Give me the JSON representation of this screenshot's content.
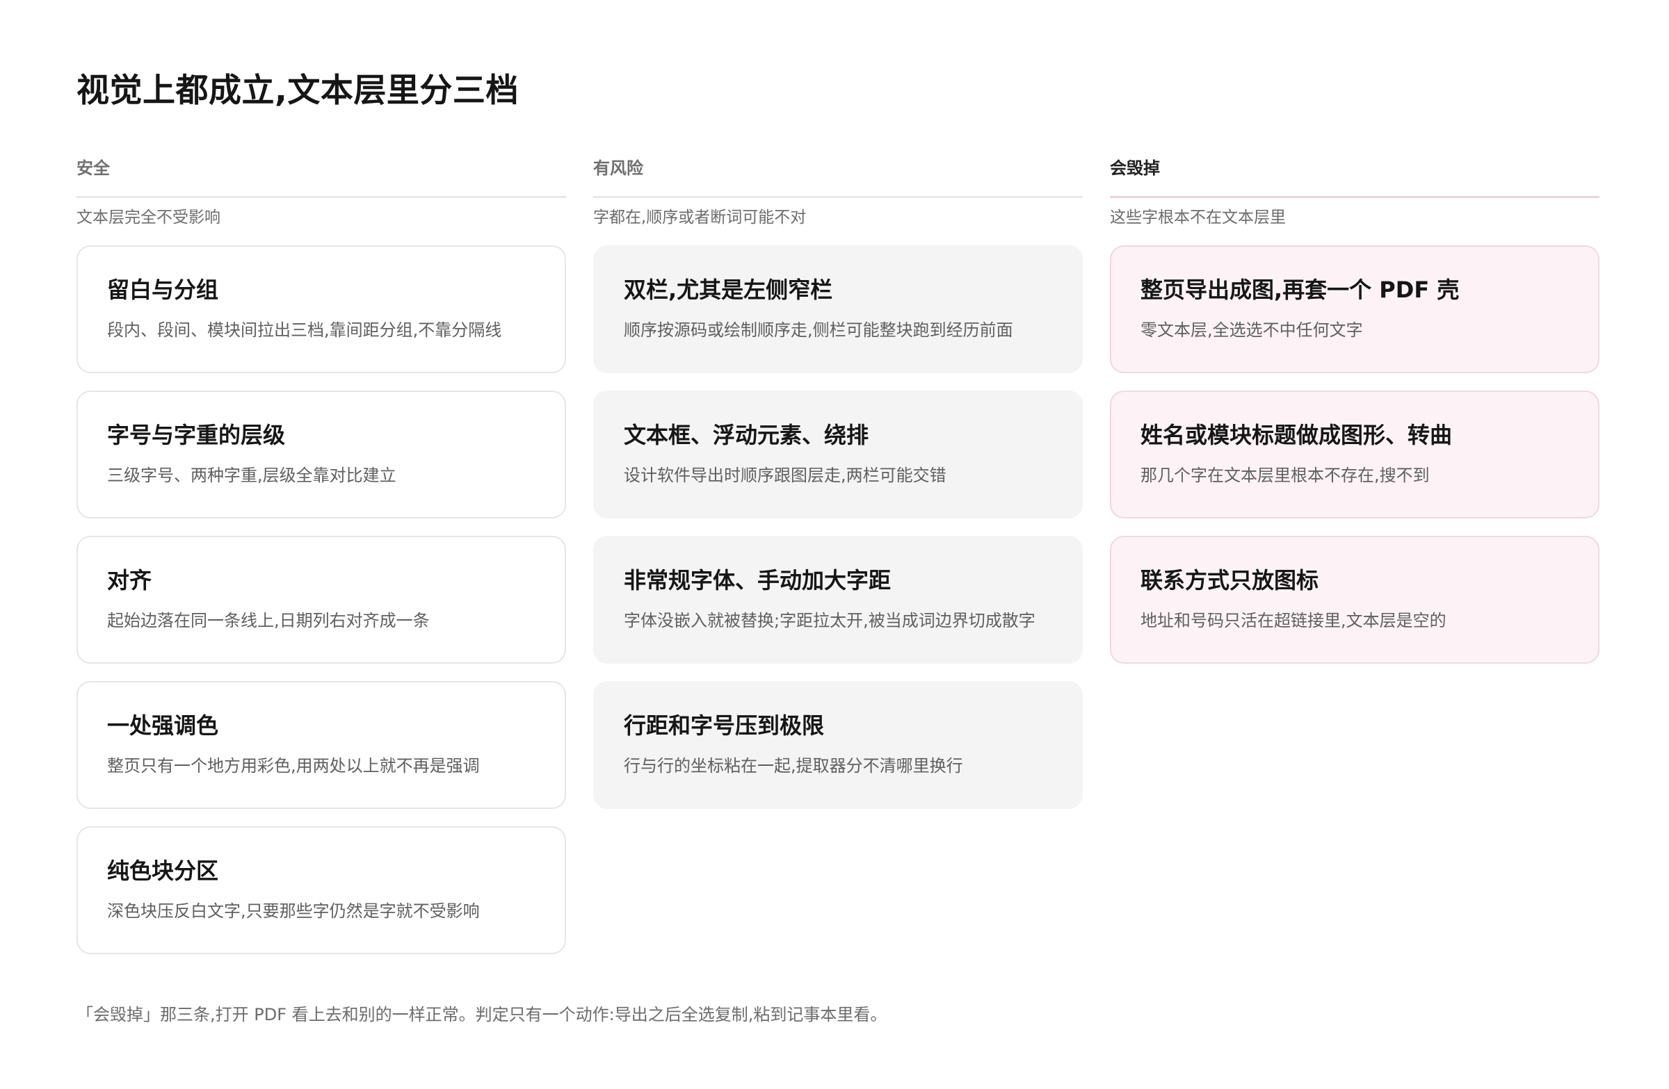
{
  "title": "视觉上都成立,文本层里分三档",
  "columns": [
    {
      "label": "安全",
      "description": "文本层完全不受影响",
      "cards": [
        {
          "title": "留白与分组",
          "text": "段内、段间、模块间拉出三档,靠间距分组,不靠分隔线"
        },
        {
          "title": "字号与字重的层级",
          "text": "三级字号、两种字重,层级全靠对比建立"
        },
        {
          "title": "对齐",
          "text": "起始边落在同一条线上,日期列右对齐成一条"
        },
        {
          "title": "一处强调色",
          "text": "整页只有一个地方用彩色,用两处以上就不再是强调"
        },
        {
          "title": "纯色块分区",
          "text": "深色块压反白文字,只要那些字仍然是字就不受影响"
        }
      ]
    },
    {
      "label": "有风险",
      "description": "字都在,顺序或者断词可能不对",
      "cards": [
        {
          "title": "双栏,尤其是左侧窄栏",
          "text": "顺序按源码或绘制顺序走,侧栏可能整块跑到经历前面"
        },
        {
          "title": "文本框、浮动元素、绕排",
          "text": "设计软件导出时顺序跟图层走,两栏可能交错"
        },
        {
          "title": "非常规字体、手动加大字距",
          "text": "字体没嵌入就被替换;字距拉太开,被当成词边界切成散字"
        },
        {
          "title": "行距和字号压到极限",
          "text": "行与行的坐标粘在一起,提取器分不清哪里换行"
        }
      ]
    },
    {
      "label": "会毁掉",
      "description": "这些字根本不在文本层里",
      "cards": [
        {
          "title": "整页导出成图,再套一个 PDF 壳",
          "text": "零文本层,全选选不中任何文字"
        },
        {
          "title": "姓名或模块标题做成图形、转曲",
          "text": "那几个字在文本层里根本不存在,搜不到"
        },
        {
          "title": "联系方式只放图标",
          "text": "地址和号码只活在超链接里,文本层是空的"
        }
      ]
    }
  ],
  "footnote": "「会毁掉」那三条,打开 PDF 看上去和别的一样正常。判定只有一个动作:导出之后全选复制,粘到记事本里看。"
}
